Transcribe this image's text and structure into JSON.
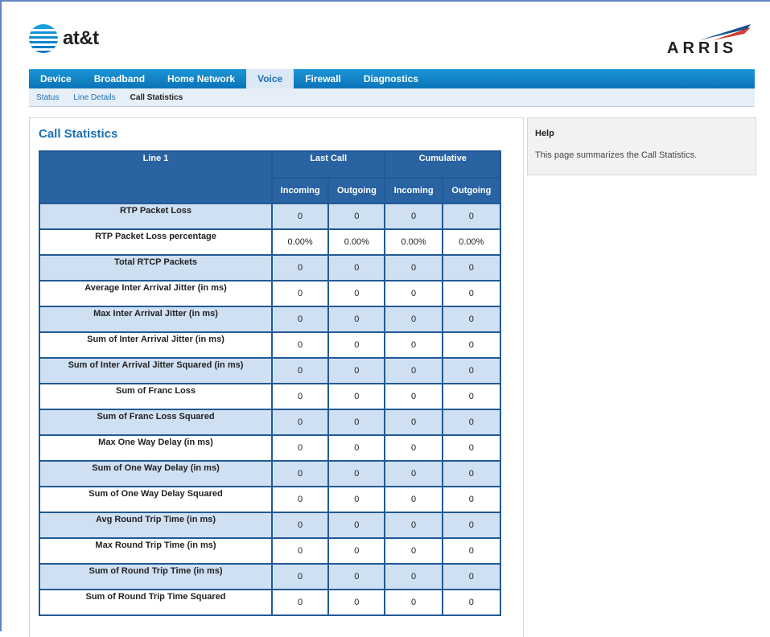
{
  "brand": {
    "att_logo_text": "at&t",
    "arris_logo_text": "ARRIS"
  },
  "nav": {
    "tabs": [
      {
        "label": "Device",
        "active": false
      },
      {
        "label": "Broadband",
        "active": false
      },
      {
        "label": "Home Network",
        "active": false
      },
      {
        "label": "Voice",
        "active": true
      },
      {
        "label": "Firewall",
        "active": false
      },
      {
        "label": "Diagnostics",
        "active": false
      }
    ],
    "subtabs": [
      {
        "label": "Status",
        "active": false
      },
      {
        "label": "Line Details",
        "active": false
      },
      {
        "label": "Call Statistics",
        "active": true
      }
    ]
  },
  "main": {
    "title": "Call Statistics",
    "table": {
      "line_header": "Line 1",
      "group_headers": [
        "Last Call",
        "Cumulative"
      ],
      "sub_headers": [
        "Incoming",
        "Outgoing",
        "Incoming",
        "Outgoing"
      ],
      "rows": [
        {
          "label": "RTP Packet Loss",
          "values": [
            "0",
            "0",
            "0",
            "0"
          ]
        },
        {
          "label": "RTP Packet Loss percentage",
          "values": [
            "0.00%",
            "0.00%",
            "0.00%",
            "0.00%"
          ]
        },
        {
          "label": "Total RTCP Packets",
          "values": [
            "0",
            "0",
            "0",
            "0"
          ]
        },
        {
          "label": "Average Inter Arrival Jitter (in ms)",
          "values": [
            "0",
            "0",
            "0",
            "0"
          ]
        },
        {
          "label": "Max Inter Arrival Jitter (in ms)",
          "values": [
            "0",
            "0",
            "0",
            "0"
          ]
        },
        {
          "label": "Sum of Inter Arrival Jitter (in ms)",
          "values": [
            "0",
            "0",
            "0",
            "0"
          ]
        },
        {
          "label": "Sum of Inter Arrival Jitter Squared (in ms)",
          "values": [
            "0",
            "0",
            "0",
            "0"
          ]
        },
        {
          "label": "Sum of Franc Loss",
          "values": [
            "0",
            "0",
            "0",
            "0"
          ]
        },
        {
          "label": "Sum of Franc Loss Squared",
          "values": [
            "0",
            "0",
            "0",
            "0"
          ]
        },
        {
          "label": "Max One Way Delay (in ms)",
          "values": [
            "0",
            "0",
            "0",
            "0"
          ]
        },
        {
          "label": "Sum of One Way Delay (in ms)",
          "values": [
            "0",
            "0",
            "0",
            "0"
          ]
        },
        {
          "label": "Sum of One Way Delay Squared",
          "values": [
            "0",
            "0",
            "0",
            "0"
          ]
        },
        {
          "label": "Avg Round Trip Time (in ms)",
          "values": [
            "0",
            "0",
            "0",
            "0"
          ]
        },
        {
          "label": "Max Round Trip Time (in ms)",
          "values": [
            "0",
            "0",
            "0",
            "0"
          ]
        },
        {
          "label": "Sum of Round Trip Time (in ms)",
          "values": [
            "0",
            "0",
            "0",
            "0"
          ]
        },
        {
          "label": "Sum of Round Trip Time Squared",
          "values": [
            "0",
            "0",
            "0",
            "0"
          ]
        }
      ]
    }
  },
  "help": {
    "title": "Help",
    "text": "This page summarizes the Call Statistics."
  },
  "colors": {
    "nav_blue": "#0b73b8",
    "table_header": "#2a63a2",
    "row_shade": "#cfe0f3",
    "title_blue": "#1c6fb4"
  }
}
